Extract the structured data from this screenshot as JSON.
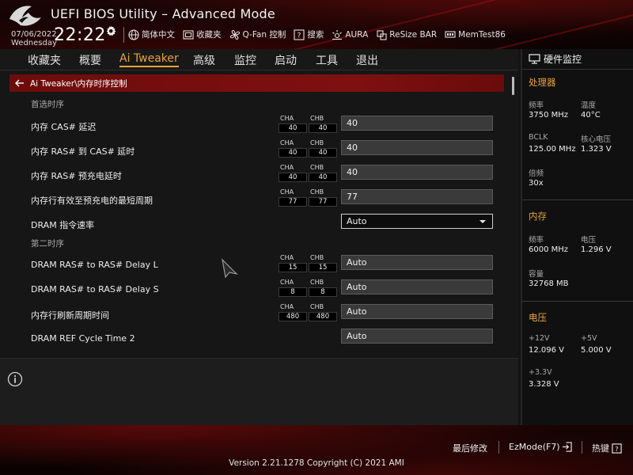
{
  "header": {
    "title": "UEFI BIOS Utility – Advanced Mode",
    "date": "07/06/2022",
    "weekday": "Wednesday",
    "time": "22:22"
  },
  "toolbar": {
    "language": "简体中文",
    "favorites": "收藏夹",
    "qfan": "Q-Fan 控制",
    "search": "搜索",
    "aura": "AURA",
    "resize_bar": "ReSize BAR",
    "memtest": "MemTest86"
  },
  "nav": {
    "tabs": [
      "收藏夹",
      "概要",
      "Ai Tweaker",
      "高级",
      "监控",
      "启动",
      "工具",
      "退出"
    ],
    "active": "Ai Tweaker"
  },
  "main": {
    "breadcrumb": "Ai Tweaker\\内存时序控制",
    "channel_labels": {
      "a": "CHA",
      "b": "CHB"
    },
    "section_primary": "首选时序",
    "section_secondary": "第二时序",
    "rows": [
      {
        "label": "内存 CAS# 延迟",
        "cha": "40",
        "chb": "40",
        "value": "40"
      },
      {
        "label": "内存 RAS# 到 CAS# 延时",
        "cha": "40",
        "chb": "40",
        "value": "40"
      },
      {
        "label": "内存 RAS# 预充电延时",
        "cha": "40",
        "chb": "40",
        "value": "40"
      },
      {
        "label": "内存行有效至预充电的最短周期",
        "cha": "77",
        "chb": "77",
        "value": "77"
      },
      {
        "label": "DRAM 指令速率",
        "value": "Auto"
      },
      {
        "label": "DRAM RAS# to RAS# Delay L",
        "cha": "15",
        "chb": "15",
        "value": "Auto"
      },
      {
        "label": "DRAM RAS# to RAS# Delay S",
        "cha": "8",
        "chb": "8",
        "value": "Auto"
      },
      {
        "label": "内存行刷新周期时间",
        "cha": "480",
        "chb": "480",
        "value": "Auto"
      },
      {
        "label": "DRAM REF Cycle Time 2",
        "value": "Auto"
      }
    ]
  },
  "monitor": {
    "title": "硬件监控",
    "cpu": {
      "section": "处理器",
      "freq_label": "频率",
      "freq": "3750 MHz",
      "temp_label": "温度",
      "temp": "40°C",
      "bclk_label": "BCLK",
      "bclk": "125.00 MHz",
      "vcore_label": "核心电压",
      "vcore": "1.323 V",
      "ratio_label": "倍频",
      "ratio": "30x"
    },
    "memory": {
      "section": "内存",
      "freq_label": "频率",
      "freq": "6000 MHz",
      "volt_label": "电压",
      "volt": "1.296 V",
      "cap_label": "容量",
      "capacity": "32768 MB"
    },
    "voltage": {
      "section": "电压",
      "v12_label": "+12V",
      "v12": "12.096 V",
      "v5_label": "+5V",
      "v5": "5.000 V",
      "v33_label": "+3.3V",
      "v33": "3.328 V"
    }
  },
  "footer": {
    "last_modified": "最后修改",
    "ezmode": "EzMode(F7)",
    "hotkeys": "热键",
    "version": "Version 2.21.1278 Copyright (C) 2021 AMI"
  },
  "colors": {
    "accent": "#e8a33c",
    "brand_red": "#7e1010"
  }
}
